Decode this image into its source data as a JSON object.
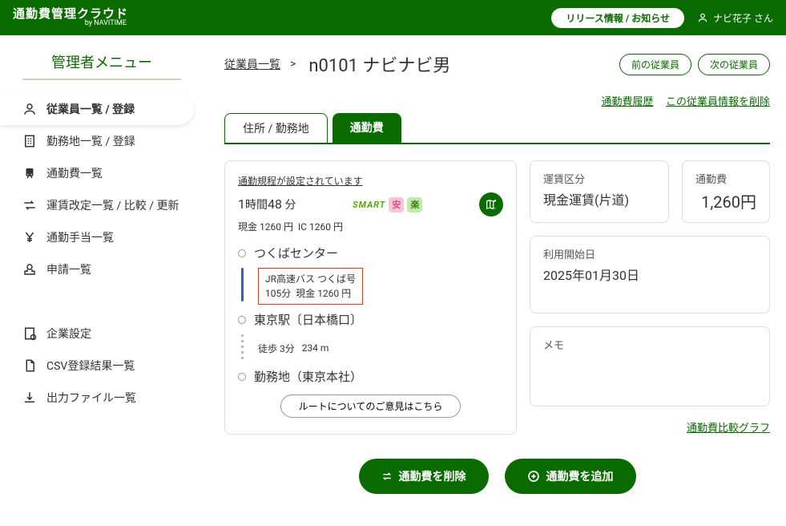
{
  "header": {
    "logo_main": "通勤費管理クラウド",
    "logo_sub": "by NAVITIME",
    "release_label": "リリース情報 / お知らせ",
    "user_name": "ナビ花子 さん"
  },
  "sidebar": {
    "title": "管理者メニュー",
    "group1": [
      {
        "label": "従業員一覧 / 登録",
        "icon": "person",
        "active": true
      },
      {
        "label": "勤務地一覧 / 登録",
        "icon": "building",
        "active": false
      },
      {
        "label": "通勤費一覧",
        "icon": "train",
        "active": false
      },
      {
        "label": "運賃改定一覧 / 比較 / 更新",
        "icon": "exchange",
        "active": false
      },
      {
        "label": "通勤手当一覧",
        "icon": "yen",
        "active": false
      },
      {
        "label": "申請一覧",
        "icon": "stamp",
        "active": false
      }
    ],
    "group2": [
      {
        "label": "企業設定",
        "icon": "building2"
      },
      {
        "label": "CSV登録結果一覧",
        "icon": "doc"
      },
      {
        "label": "出力ファイル一覧",
        "icon": "download"
      }
    ]
  },
  "breadcrumb": {
    "back_label": "従業員一覧",
    "sep": ">",
    "current": "n0101 ナビナビ男"
  },
  "nav": {
    "prev": "前の従業員",
    "next": "次の従業員"
  },
  "top_links": {
    "history": "通勤費履歴",
    "delete_emp": "この従業員情報を削除"
  },
  "tabs": {
    "address": "住所 / 勤務地",
    "commute": "通勤費"
  },
  "route": {
    "notice": "通勤規程が設定されています",
    "time_h": "1",
    "time_h_unit": "時間",
    "time_m": "48",
    "time_m_unit": "分",
    "badge_smart": "SMART",
    "badge_an": "安",
    "badge_raku": "楽",
    "cash_label": "現金",
    "cash_value": "1260",
    "cash_unit": "円",
    "ic_label": "IC",
    "ic_value": "1260",
    "ic_unit": "円",
    "stops": [
      {
        "name": "つくばセンター"
      },
      {
        "name": "東京駅〔日本橋口〕"
      },
      {
        "name": "勤務地（東京本社）"
      }
    ],
    "leg1": {
      "line": "JR高速バス つくば号",
      "duration": "105分",
      "fare_label": "現金",
      "fare_value": "1260",
      "fare_unit": "円"
    },
    "leg2": {
      "mode": "徒歩",
      "duration": "3分",
      "distance": "234 m"
    },
    "feedback": "ルートについてのご意見はこちら"
  },
  "info": {
    "fare_type_label": "運賃区分",
    "fare_type_value": "現金運賃(片道)",
    "commute_cost_label": "通勤費",
    "commute_cost_value": "1,260円",
    "start_date_label": "利用開始日",
    "start_date_value": "2025年01月30日",
    "memo_label": "メモ",
    "compare_link": "通勤費比較グラフ"
  },
  "actions": {
    "delete": "通勤費を削除",
    "add": "通勤費を追加"
  }
}
